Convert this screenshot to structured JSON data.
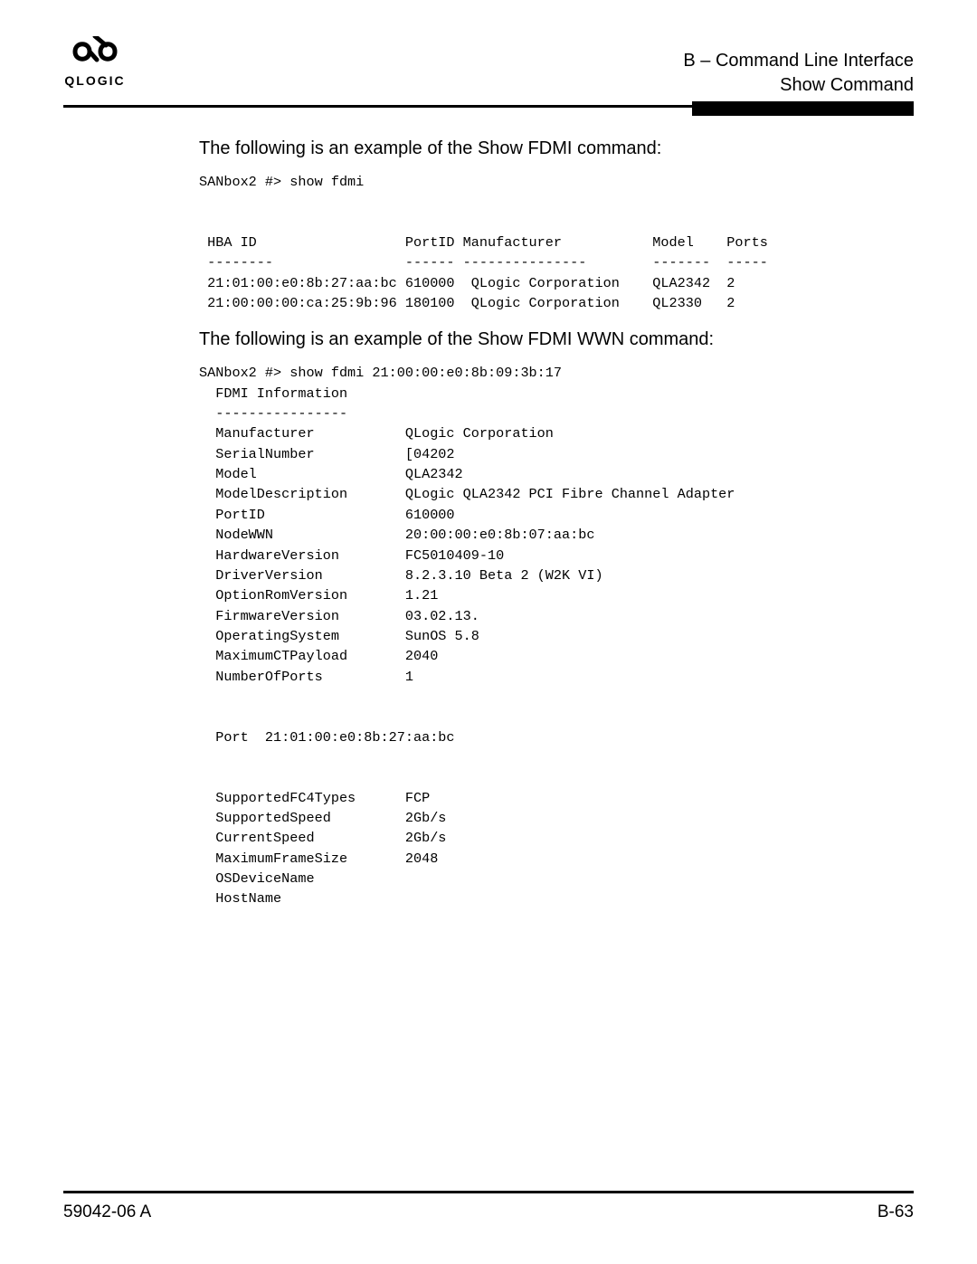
{
  "header": {
    "logo_mark": "꩜",
    "logo_text": "QLOGIC",
    "line1": "B – Command Line Interface",
    "line2": "Show Command"
  },
  "intro1": "The following is an example of the Show FDMI command:",
  "block1": "SANbox2 #> show fdmi\n\n\n HBA ID                  PortID Manufacturer           Model    Ports\n --------                ------ ---------------        -------  -----\n 21:01:00:e0:8b:27:aa:bc 610000  QLogic Corporation    QLA2342  2\n 21:00:00:00:ca:25:9b:96 180100  QLogic Corporation    QL2330   2",
  "intro2": "The following is an example of the Show FDMI WWN command:",
  "block2": "SANbox2 #> show fdmi 21:00:00:e0:8b:09:3b:17\n  FDMI Information\n  ----------------\n  Manufacturer           QLogic Corporation\n  SerialNumber           [04202\n  Model                  QLA2342\n  ModelDescription       QLogic QLA2342 PCI Fibre Channel Adapter\n  PortID                 610000\n  NodeWWN                20:00:00:e0:8b:07:aa:bc\n  HardwareVersion        FC5010409-10\n  DriverVersion          8.2.3.10 Beta 2 (W2K VI)\n  OptionRomVersion       1.21\n  FirmwareVersion        03.02.13.\n  OperatingSystem        SunOS 5.8\n  MaximumCTPayload       2040\n  NumberOfPorts          1\n\n\n  Port  21:01:00:e0:8b:27:aa:bc\n\n\n  SupportedFC4Types      FCP\n  SupportedSpeed         2Gb/s\n  CurrentSpeed           2Gb/s\n  MaximumFrameSize       2048\n  OSDeviceName           \n  HostName               ",
  "footer": {
    "left": "59042-06 A",
    "right": "B-63"
  }
}
